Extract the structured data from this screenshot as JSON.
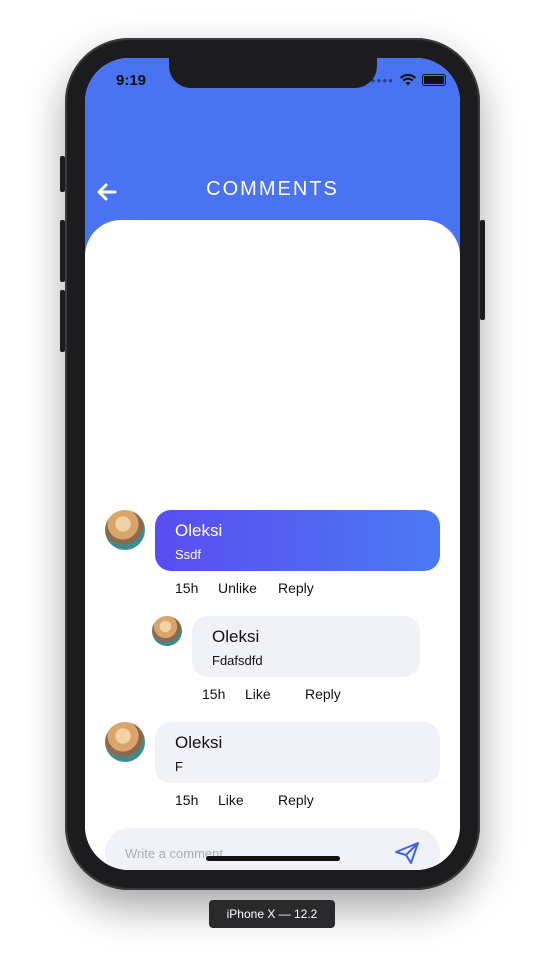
{
  "status_bar": {
    "time": "9:19"
  },
  "header": {
    "title": "COMMENTS"
  },
  "comments": [
    {
      "author": "Oleksi",
      "text": "Ssdf",
      "time": "15h",
      "like_label": "Unlike",
      "reply_label": "Reply",
      "liked": true
    },
    {
      "author": "Oleksi",
      "text": "Fdafsdfd",
      "time": "15h",
      "like_label": "Like",
      "reply_label": "Reply",
      "liked": false
    },
    {
      "author": "Oleksi",
      "text": "F",
      "time": "15h",
      "like_label": "Like",
      "reply_label": "Reply",
      "liked": false
    }
  ],
  "composer": {
    "placeholder": "Write a comment...",
    "value": ""
  },
  "device_label": "iPhone X — 12.2",
  "colors": {
    "header": "#4a73f2",
    "bubble_active_start": "#5a4cf0",
    "bubble_active_end": "#4a7af2",
    "bubble_plain": "#f0f2f7",
    "send_icon": "#3f63e8"
  }
}
